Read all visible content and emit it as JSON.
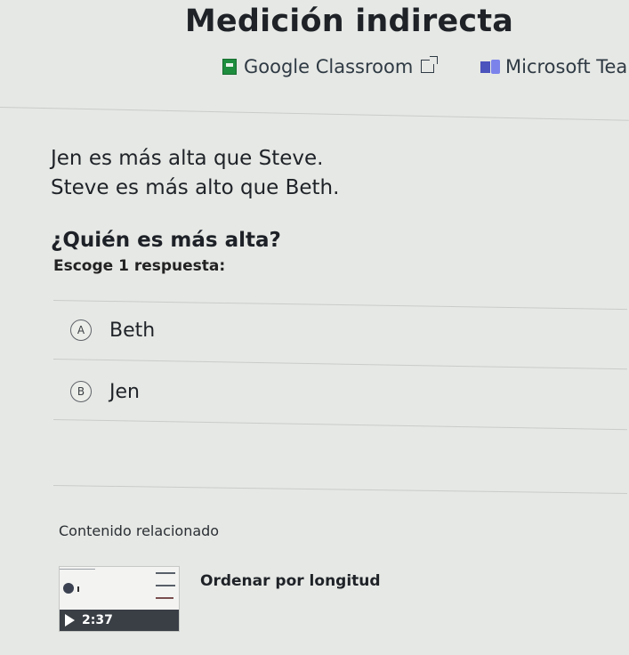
{
  "page": {
    "title": "Medición indirecta"
  },
  "share": {
    "google_classroom": "Google Classroom",
    "microsoft_teams": "Microsoft Tea"
  },
  "problem": {
    "lines": [
      "Jen es más alta que Steve.",
      "Steve es más alto que Beth."
    ],
    "question": "¿Quién es más alta?",
    "instruction": "Escoge 1 respuesta:",
    "options": [
      {
        "letter": "A",
        "label": "Beth"
      },
      {
        "letter": "B",
        "label": "Jen"
      }
    ]
  },
  "related": {
    "heading": "Contenido relacionado",
    "item": {
      "title": "Ordenar por longitud",
      "duration": "2:37"
    }
  }
}
